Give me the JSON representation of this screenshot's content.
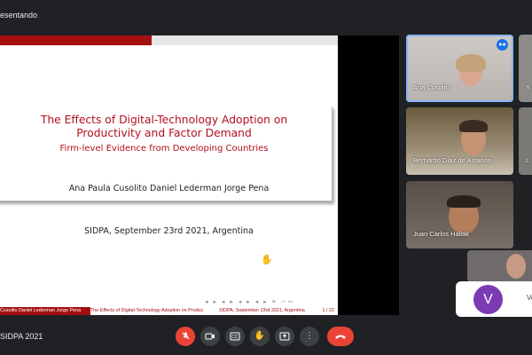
{
  "top_bar": {
    "presenting_label": "esentando"
  },
  "slide": {
    "title_line1": "The Effects of Digital-Technology Adoption on",
    "title_line2": "Productivity and Factor Demand",
    "subtitle": "Firm-level Evidence from Developing Countries",
    "authors": "Ana Paula Cusolito  Daniel Lederman  Jorge Pena",
    "event": "SIDPA, September 23rd 2021, Argentina",
    "nav_icons": "◂ ▸ ◂ ▸ ◂ ▸ ◂ ▸ ≡ ∽∾",
    "footer_authors": "Cusolito  Daniel Lederman  Jorge Pena",
    "footer_title": "The Effects of Digital-Technology Adoption on Produc",
    "footer_event": "SIDPA, September 23rd 2021, Argentina",
    "footer_page": "1 / 22"
  },
  "participants": [
    {
      "name": "Ana Cusolito",
      "speaking": true
    },
    {
      "name": "Bernardo Díaz de Astarloa"
    },
    {
      "name": "Juan Carlos Hallak"
    }
  ],
  "side_labels": {
    "s1": "S",
    "s2": "L"
  },
  "participant_card": {
    "avatar_letter": "V",
    "label": "Ve"
  },
  "bottom_bar": {
    "meeting_name": "SIDPA 2021",
    "controls": [
      "microphone-off-icon",
      "camera-icon",
      "captions-icon",
      "raise-hand-icon",
      "present-icon",
      "more-options-icon",
      "end-call-icon"
    ]
  },
  "colors": {
    "slide_accent": "#a50f0f",
    "title_text": "#b20f1e",
    "meet_background": "#202124",
    "end_call": "#ea4335",
    "avatar": "#7b3bb3"
  }
}
